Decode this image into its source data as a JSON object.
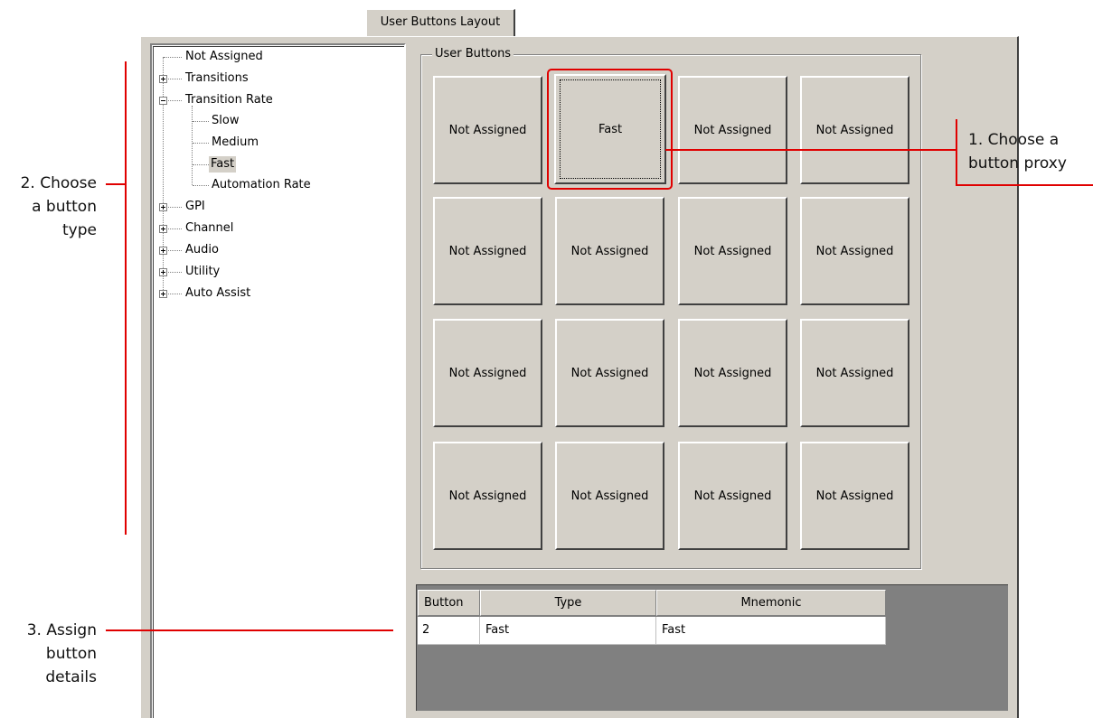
{
  "tab": {
    "label": "User Buttons Layout"
  },
  "tree": {
    "items": [
      {
        "label": "Not Assigned",
        "expander": "none"
      },
      {
        "label": "Transitions",
        "expander": "plus"
      },
      {
        "label": "Transition Rate",
        "expander": "minus"
      },
      {
        "label": "Slow",
        "expander": "none"
      },
      {
        "label": "Medium",
        "expander": "none"
      },
      {
        "label": "Fast",
        "expander": "none",
        "selected": true
      },
      {
        "label": "Automation Rate",
        "expander": "none"
      },
      {
        "label": "GPI",
        "expander": "plus"
      },
      {
        "label": "Channel",
        "expander": "plus"
      },
      {
        "label": "Audio",
        "expander": "plus"
      },
      {
        "label": "Utility",
        "expander": "plus"
      },
      {
        "label": "Auto Assist",
        "expander": "plus"
      }
    ]
  },
  "user_buttons": {
    "group_label": "User Buttons",
    "buttons": [
      "Not Assigned",
      "Fast",
      "Not Assigned",
      "Not Assigned",
      "Not Assigned",
      "Not Assigned",
      "Not Assigned",
      "Not Assigned",
      "Not Assigned",
      "Not Assigned",
      "Not Assigned",
      "Not Assigned",
      "Not Assigned",
      "Not Assigned",
      "Not Assigned",
      "Not Assigned"
    ],
    "selected_index": 1
  },
  "details_table": {
    "columns": [
      "Button",
      "Type",
      "Mnemonic"
    ],
    "rows": [
      [
        "2",
        "Fast",
        "Fast"
      ]
    ]
  },
  "annotations": {
    "choose_proxy_line1": "1. Choose a",
    "choose_proxy_line2": "button proxy",
    "choose_type_line1": "2. Choose",
    "choose_type_line2": "a button",
    "choose_type_line3": "type",
    "assign_line1": "3. Assign",
    "assign_line2": "button",
    "assign_line3": "details"
  },
  "colors": {
    "annotation_red": "#e00000",
    "face": "#d4d0c8",
    "table_background": "#808080"
  }
}
